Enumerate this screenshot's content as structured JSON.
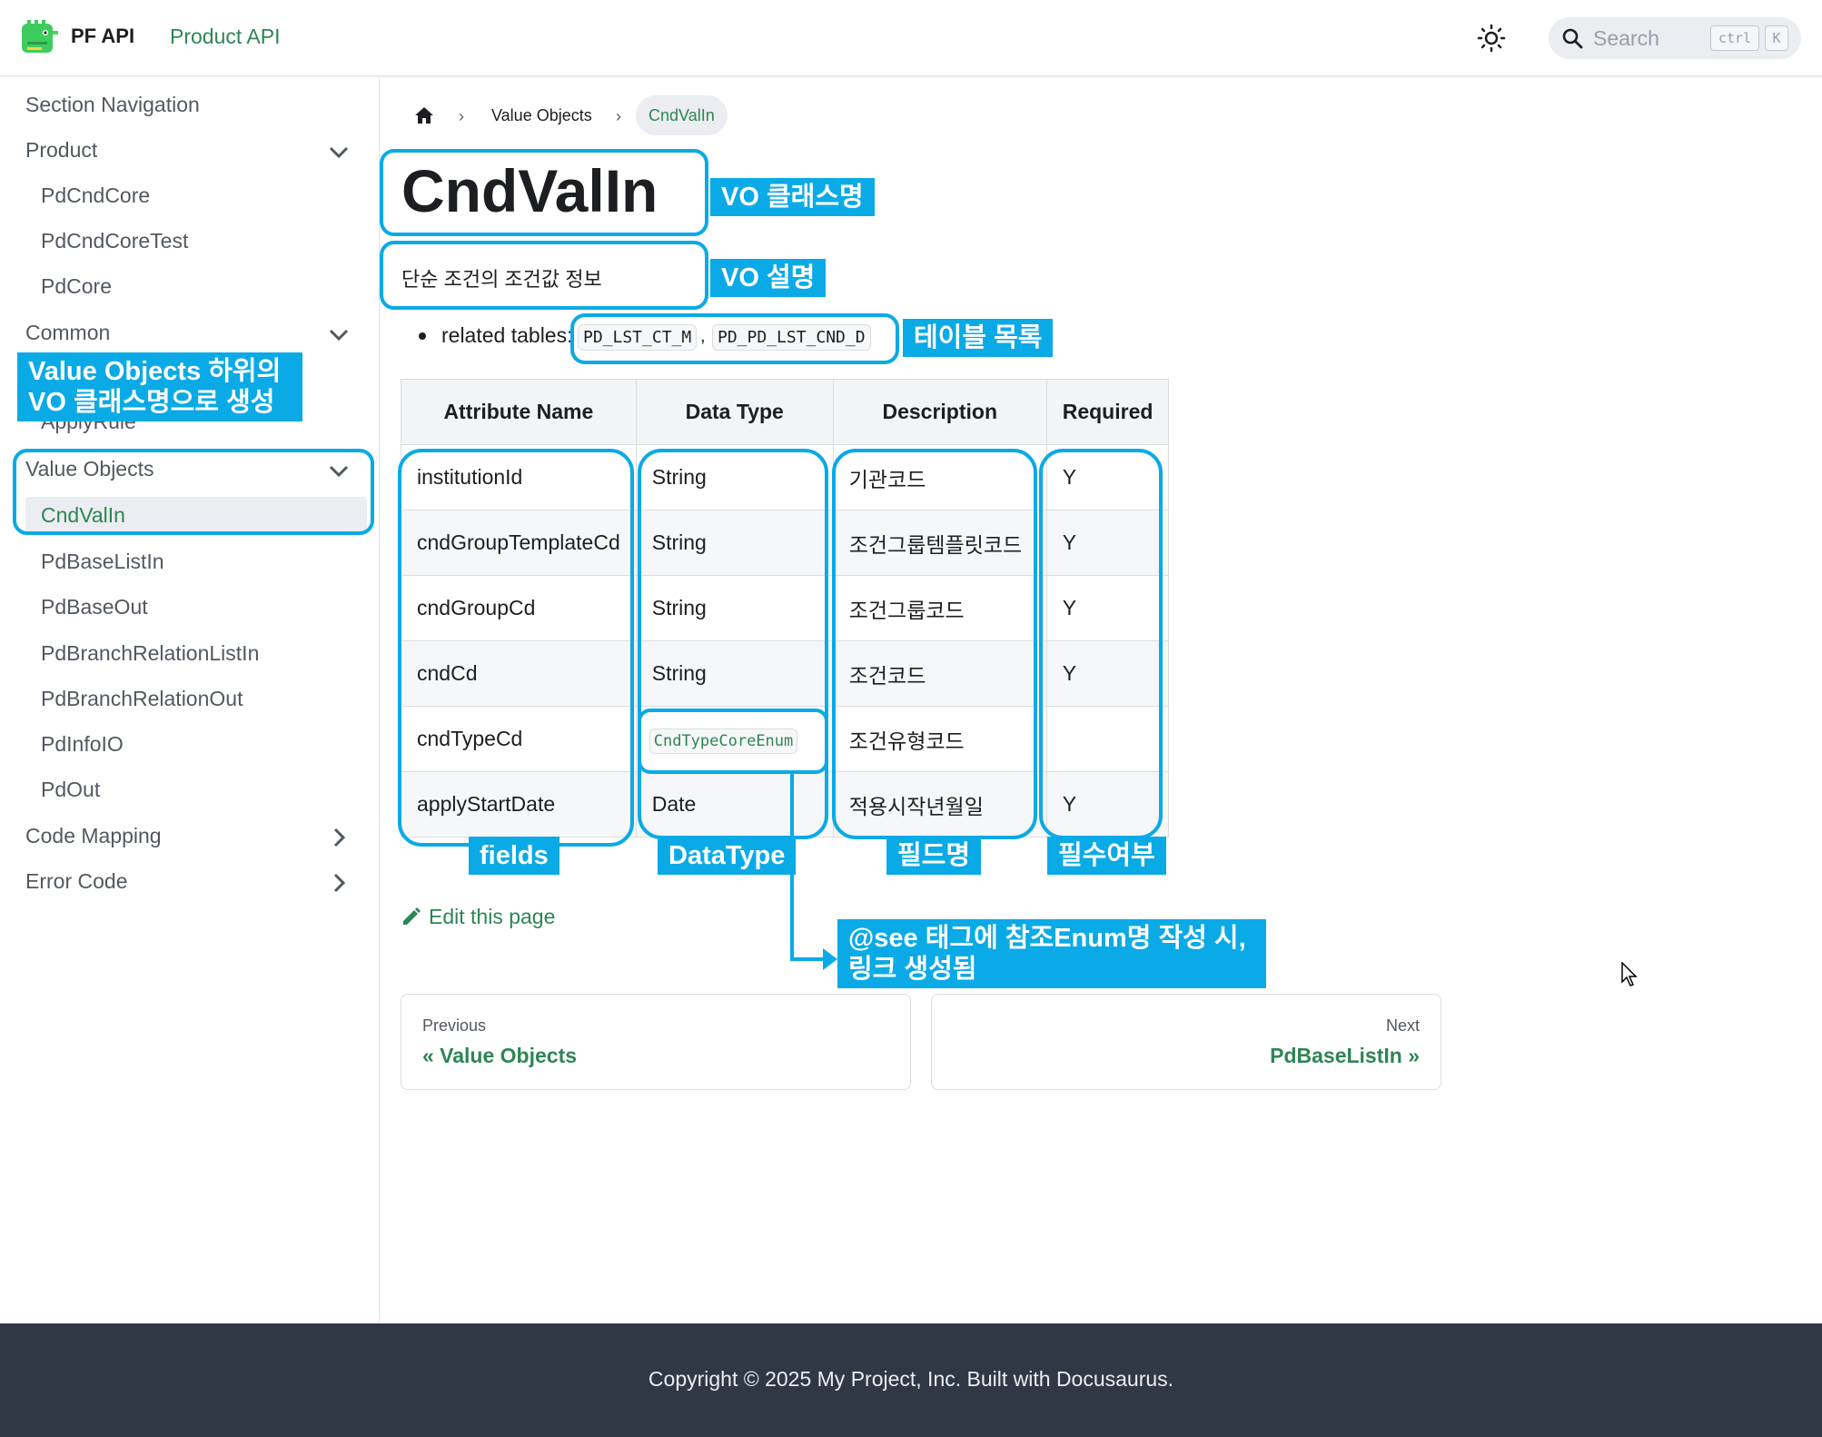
{
  "navbar": {
    "brand": "PF API",
    "link": "Product API",
    "search_placeholder": "Search",
    "kbd_ctrl": "ctrl",
    "kbd_k": "K"
  },
  "sidebar": {
    "heading": "Section Navigation",
    "product": "Product",
    "product_items": [
      "PdCndCore",
      "PdCndCoreTest",
      "PdCore"
    ],
    "common": "Common",
    "apply_rule": "ApplyRule",
    "value_objects": "Value Objects",
    "vo_items": [
      "CndValIn",
      "PdBaseListIn",
      "PdBaseOut",
      "PdBranchRelationListIn",
      "PdBranchRelationOut",
      "PdInfoIO",
      "PdOut"
    ],
    "code_mapping": "Code Mapping",
    "error_code": "Error Code"
  },
  "breadcrumb": {
    "parent": "Value Objects",
    "current": "CndValIn"
  },
  "doc": {
    "title": "CndValIn",
    "description": "단순 조건의 조건값 정보",
    "related_label": "related tables:",
    "tables": [
      "PD_LST_CT_M",
      "PD_PD_LST_CND_D"
    ]
  },
  "table": {
    "headers": [
      "Attribute Name",
      "Data Type",
      "Description",
      "Required"
    ],
    "rows": [
      {
        "name": "institutionId",
        "type": "String",
        "desc": "기관코드",
        "req": "Y"
      },
      {
        "name": "cndGroupTemplateCd",
        "type": "String",
        "desc": "조건그룹템플릿코드",
        "req": "Y"
      },
      {
        "name": "cndGroupCd",
        "type": "String",
        "desc": "조건그룹코드",
        "req": "Y"
      },
      {
        "name": "cndCd",
        "type": "String",
        "desc": "조건코드",
        "req": "Y"
      },
      {
        "name": "cndTypeCd",
        "type": "CndTypeCoreEnum",
        "desc": "조건유형코드",
        "req": ""
      },
      {
        "name": "applyStartDate",
        "type": "Date",
        "desc": "적용시작년월일",
        "req": "Y"
      }
    ]
  },
  "edit_label": "Edit this page",
  "pager": {
    "prev_sub": "Previous",
    "prev_label": "« Value Objects",
    "next_sub": "Next",
    "next_label": "PdBaseListIn »"
  },
  "footer": "Copyright © 2025 My Project, Inc. Built with Docusaurus.",
  "annotations": {
    "vo_class": "VO 클래스명",
    "vo_desc": "VO 설명",
    "table_list": "테이블 목록",
    "sidebar_note_1": "Value Objects 하위의",
    "sidebar_note_2": "VO 클래스명으로 생성",
    "fields": "fields",
    "datatype": "DataType",
    "field_name": "필드명",
    "required": "필수여부",
    "see_note_1": "@see 태그에 참조Enum명 작성 시,",
    "see_note_2": "링크 생성됨"
  },
  "colors": {
    "accent": "#2e8555",
    "annotation": "#0aaae6",
    "footer_bg": "#303846"
  }
}
